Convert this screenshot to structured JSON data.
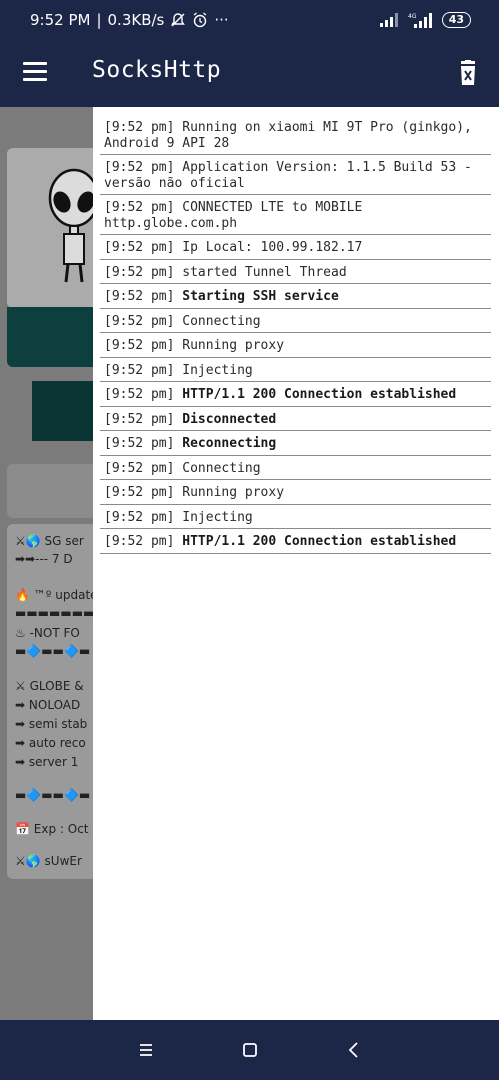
{
  "status_bar": {
    "time": "9:52 PM",
    "speed": "0.3KB/s",
    "more": "···",
    "battery": "43"
  },
  "app_bar": {
    "title": "SocksHttp"
  },
  "background": {
    "lines": [
      {
        "icon": "⚔🌎",
        "text": "SG ser"
      },
      {
        "icon": "➡➡",
        "text": "--- 7 D"
      },
      {
        "icon": "🔥",
        "text": "™º update"
      },
      {
        "icon": "▬▬▬",
        "text": "▬▬▬▬"
      },
      {
        "icon": "♨",
        "text": "-NOT FO"
      },
      {
        "icon": "▬🔷▬",
        "text": "▬🔷▬"
      },
      {
        "icon": "⚔",
        "text": "GLOBE &"
      },
      {
        "icon": "➡",
        "text": "NOLOAD"
      },
      {
        "icon": "➡",
        "text": "semi stab"
      },
      {
        "icon": "➡",
        "text": "auto reco"
      },
      {
        "icon": "➡",
        "text": "server 1"
      },
      {
        "icon": "▬🔷▬",
        "text": "▬🔷▬"
      },
      {
        "icon": "📅",
        "text": "Exp : Oct"
      },
      {
        "icon": "⚔🌎",
        "text": "sUwEr"
      }
    ]
  },
  "log": [
    {
      "time": "[9:52 pm]",
      "msg": "Running on xiaomi MI 9T Pro (ginkgo),\nAndroid 9 API 28",
      "bold": false
    },
    {
      "time": "[9:52 pm]",
      "msg": "Application Version: 1.1.5 Build 53 -\nversão não oficial",
      "bold": false
    },
    {
      "time": "[9:52 pm]",
      "msg": "CONNECTED LTE to MOBILE\nhttp.globe.com.ph",
      "bold": false
    },
    {
      "time": "[9:52 pm]",
      "msg": "Ip Local: 100.99.182.17",
      "bold": false
    },
    {
      "time": "[9:52 pm]",
      "msg": "started Tunnel Thread",
      "bold": false
    },
    {
      "time": "[9:52 pm]",
      "msg": "Starting SSH service",
      "bold": true
    },
    {
      "time": "[9:52 pm]",
      "msg": "Connecting",
      "bold": false
    },
    {
      "time": "[9:52 pm]",
      "msg": "Running proxy",
      "bold": false
    },
    {
      "time": "[9:52 pm]",
      "msg": "Injecting",
      "bold": false
    },
    {
      "time": "[9:52 pm]",
      "msg": "HTTP/1.1 200 Connection established",
      "bold": true
    },
    {
      "time": "[9:52 pm]",
      "msg": "Disconnected",
      "bold": true
    },
    {
      "time": "[9:52 pm]",
      "msg": "Reconnecting",
      "bold": true
    },
    {
      "time": "[9:52 pm]",
      "msg": "Connecting",
      "bold": false
    },
    {
      "time": "[9:52 pm]",
      "msg": "Running proxy",
      "bold": false
    },
    {
      "time": "[9:52 pm]",
      "msg": "Injecting",
      "bold": false
    },
    {
      "time": "[9:52 pm]",
      "msg": "HTTP/1.1 200 Connection established",
      "bold": true
    }
  ],
  "colors": {
    "bar": "#1c2647",
    "drawer": "#ffffff",
    "scrim": "#7b7b7b",
    "teal": "#0d3f3f"
  }
}
